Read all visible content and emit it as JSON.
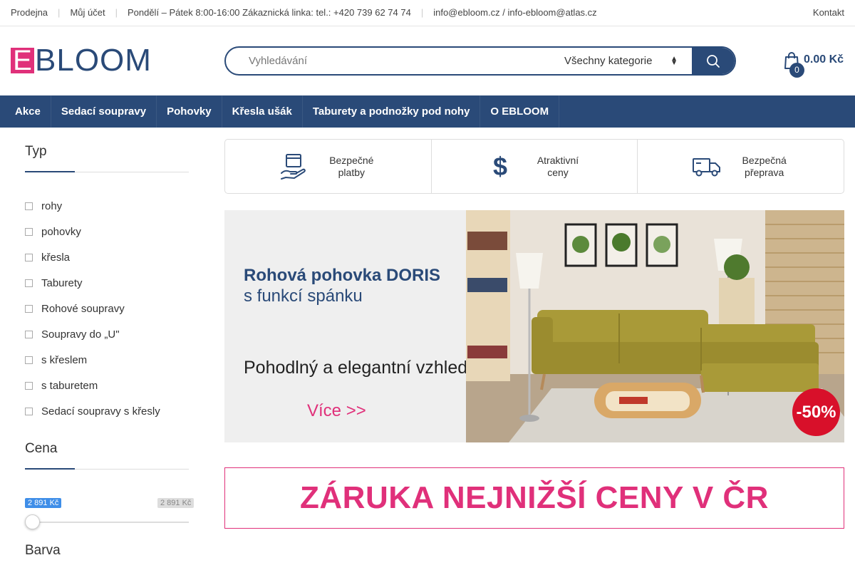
{
  "topbar": {
    "store": "Prodejna",
    "account": "Můj účet",
    "hours": "Pondělí – Pátek 8:00-16:00 Zákaznická linka: tel.: +420 739 62 74 74",
    "emails": "info@ebloom.cz / info-ebloom@atlas.cz",
    "contact": "Kontakt"
  },
  "logo": {
    "letter": "E",
    "rest": "BLOOM"
  },
  "search": {
    "placeholder": "Vyhledávání",
    "category": "Všechny kategorie"
  },
  "cart": {
    "count": "0",
    "total": "0.00 Kč"
  },
  "nav": [
    "Akce",
    "Sedací soupravy",
    "Pohovky",
    "Křesla ušák",
    "Taburety a podnožky pod nohy",
    "O EBLOOM"
  ],
  "sidebar": {
    "type_heading": "Typ",
    "types": [
      "rohy",
      "pohovky",
      "křesla",
      "Taburety",
      "Rohové soupravy",
      "Soupravy do „U\"",
      "s křeslem",
      "s taburetem",
      "Sedací soupravy s křesly"
    ],
    "price_heading": "Cena",
    "price_min": "2 891 Kč",
    "price_max": "2 891 Kč",
    "color_heading": "Barva"
  },
  "features": [
    {
      "icon": "hand-payment-icon",
      "text": "Bezpečné\nplatby"
    },
    {
      "icon": "dollar-icon",
      "text": "Atraktivní\nceny"
    },
    {
      "icon": "truck-icon",
      "text": "Bezpečná\npřeprava"
    }
  ],
  "banner": {
    "title": "Rohová pohovka DORIS",
    "subtitle": "s funkcí spánku",
    "description": "Pohodlný a elegantní vzhled",
    "more": "Více  >>",
    "discount": "-50%"
  },
  "guarantee": "ZÁRUKA NEJNIŽŠÍ CENY V ČR",
  "colors": {
    "primary": "#2a4a78",
    "accent": "#e0307a",
    "discount": "#d8102a"
  }
}
